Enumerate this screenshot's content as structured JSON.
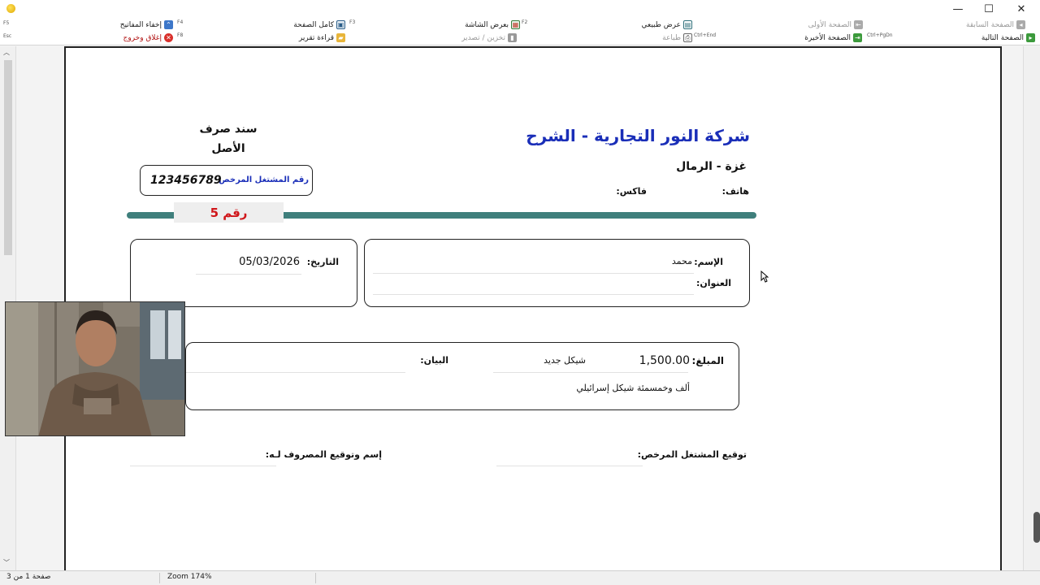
{
  "window": {
    "minimize_glyph": "—",
    "maximize_glyph": "☐",
    "close_glyph": "✕"
  },
  "toolbar": {
    "row1": [
      {
        "id": "prev_page",
        "label": "الصفحة السابقة",
        "key": "",
        "disabled": true,
        "icon": "prev-page-icon"
      },
      {
        "id": "first_page",
        "label": "الصفحة الأولى",
        "key": "",
        "disabled": true,
        "icon": "first-page-icon"
      },
      {
        "id": "normal_view",
        "label": "عرض طبيعي",
        "key": "",
        "disabled": false,
        "icon": "normal-view-icon"
      },
      {
        "id": "screen_width",
        "label": "بعرض الشاشة",
        "key": "F2",
        "disabled": false,
        "icon": "screen-width-icon"
      },
      {
        "id": "full_page",
        "label": "كامل الصفحة",
        "key": "F3",
        "disabled": false,
        "icon": "full-page-icon"
      },
      {
        "id": "hide_keys",
        "label": "إخفاء المفاتيح",
        "key": "F4",
        "disabled": false,
        "icon": "hide-keys-icon"
      }
    ],
    "row2": [
      {
        "id": "next_page",
        "label": "الصفحة التالية",
        "key": "",
        "disabled": false,
        "icon": "next-page-icon"
      },
      {
        "id": "last_page",
        "label": "الصفحة الأخيرة",
        "key": "Ctrl+PgDn",
        "disabled": false,
        "icon": "last-page-icon"
      },
      {
        "id": "print",
        "label": "طباعة",
        "key": "Ctrl+End",
        "disabled": true,
        "icon": "printer-icon"
      },
      {
        "id": "save_export",
        "label": "تخزين / تصدير",
        "key": "",
        "disabled": true,
        "icon": "export-icon"
      },
      {
        "id": "read_report",
        "label": "قراءة تقرير",
        "key": "",
        "disabled": false,
        "icon": "folder-open-icon"
      },
      {
        "id": "close_exit",
        "label": "إغلاق وخروج",
        "key": "F8",
        "disabled": false,
        "icon": "close-exit-icon"
      }
    ],
    "f5_key": "F5",
    "esc_key": "Esc"
  },
  "voucher": {
    "company_name": "شركة النور التجارية - الشرح",
    "city": "غزة - الرمال",
    "phone_label": "هاتف:",
    "fax_label": "فاكس:",
    "doc_type": "سند صرف",
    "doc_copy": "الأصل",
    "license_label": "رقم المشتغل المرخص",
    "license_number": "123456789",
    "number_text": "رقم 5",
    "name_label": "الإسم:",
    "name_value": "محمد",
    "address_label": "العنوان:",
    "date_label": "التاريخ:",
    "date_value": "05/03/2026",
    "amount_label": "المبلغ:",
    "amount_value": "1,500.00",
    "currency": "شيكل جديد",
    "description_label": "البيان:",
    "amount_words": "ألف وخمسمئة شيكل إسرائيلي",
    "signature_licensee": "توقيع المشتغل المرخص:",
    "signature_recipient": "إسم وتوقيع المصروف لـه:"
  },
  "status": {
    "page_info": "صفحة 1 من 3",
    "zoom": "Zoom 174%"
  },
  "colors": {
    "company_blue": "#1a2eb8",
    "number_red": "#d0161a",
    "bar_teal": "#3f7f7c"
  }
}
